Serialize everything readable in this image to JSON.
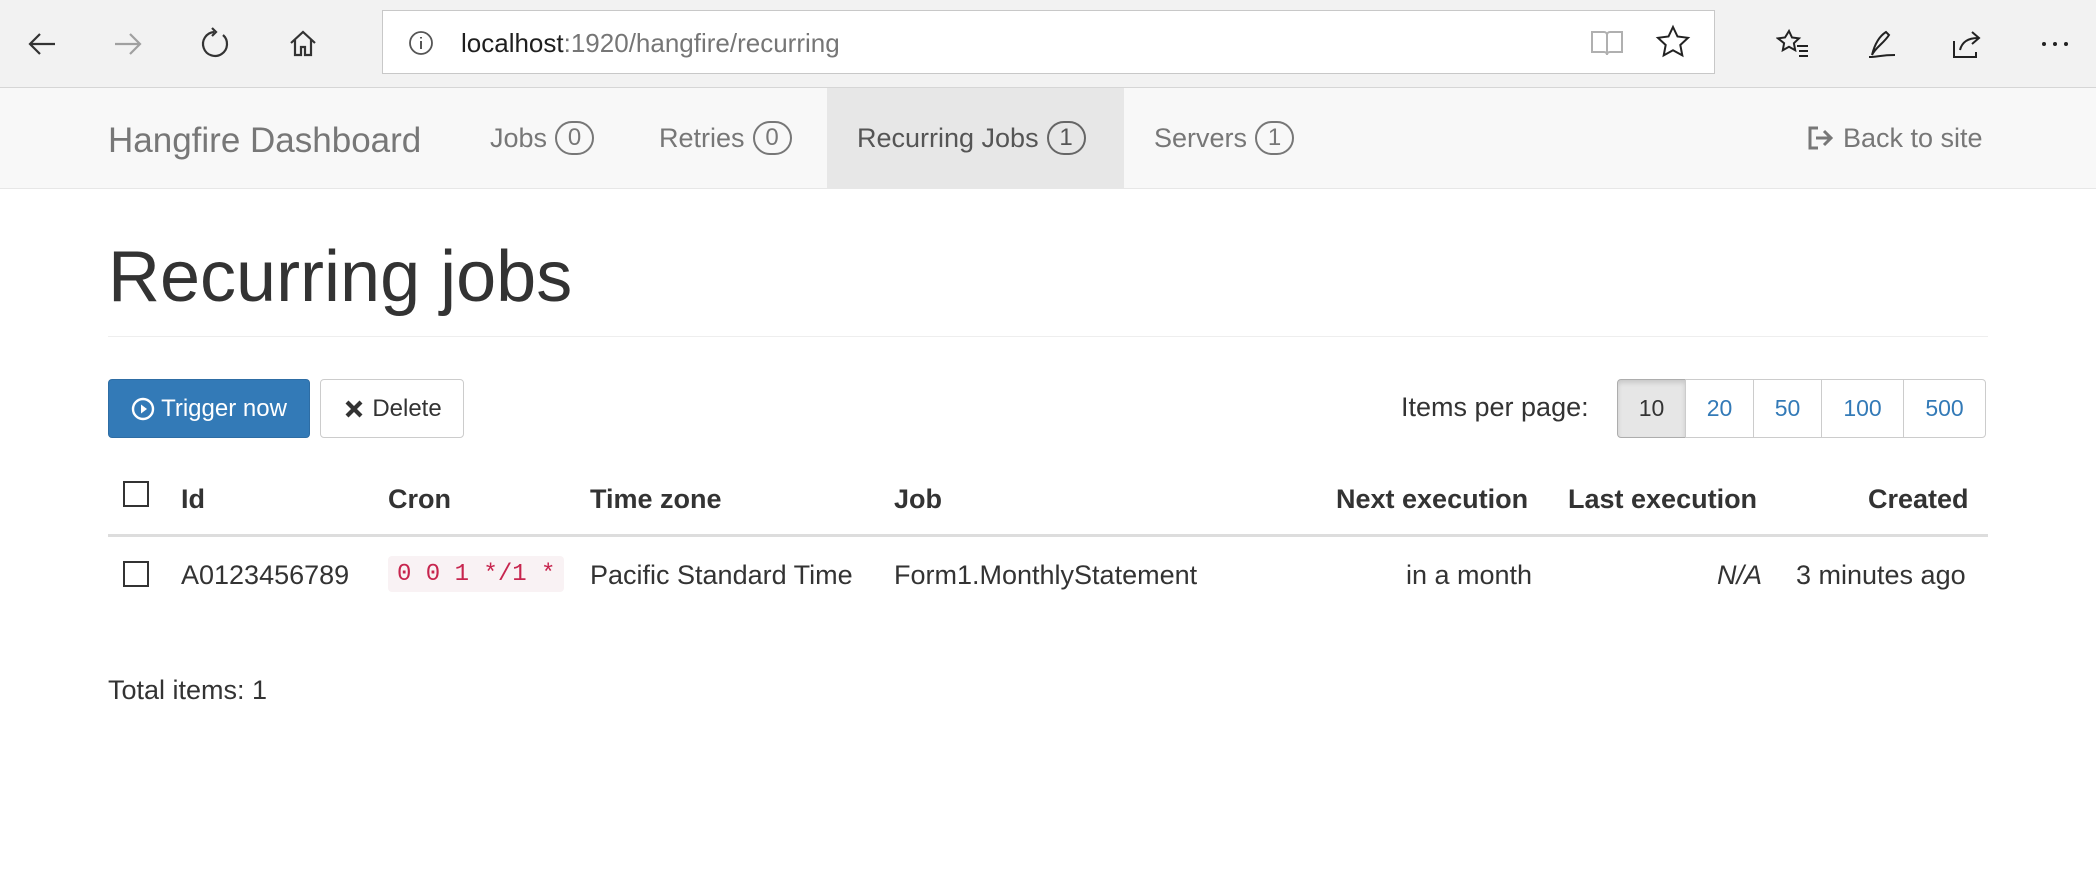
{
  "browser": {
    "url_host": "localhost",
    "url_path": ":1920/hangfire/recurring"
  },
  "navbar": {
    "brand": "Hangfire Dashboard",
    "items": [
      {
        "label": "Jobs",
        "count": "0",
        "active": false
      },
      {
        "label": "Retries",
        "count": "0",
        "active": false
      },
      {
        "label": "Recurring Jobs",
        "count": "1",
        "active": true
      },
      {
        "label": "Servers",
        "count": "1",
        "active": false
      }
    ],
    "back_label": "Back to site"
  },
  "page": {
    "title": "Recurring jobs",
    "trigger_label": "Trigger now",
    "delete_label": "Delete",
    "items_per_page_label": "Items per page:",
    "page_sizes": [
      "10",
      "20",
      "50",
      "100",
      "500"
    ],
    "selected_page_size": "10",
    "total_label": "Total items: 1"
  },
  "table": {
    "columns": [
      "Id",
      "Cron",
      "Time zone",
      "Job",
      "Next execution",
      "Last execution",
      "Created"
    ],
    "rows": [
      {
        "id": "A0123456789",
        "cron": "0 0 1 */1 *",
        "time_zone": "Pacific Standard Time",
        "job": "Form1.MonthlyStatement",
        "next_execution": "in a month",
        "last_execution": "N/A",
        "created": "3 minutes ago"
      }
    ]
  },
  "colors": {
    "primary": "#337ab7",
    "cron_text": "#c7254e",
    "cron_bg": "#f9f2f4",
    "navbar_bg": "#f8f8f8",
    "nav_active_bg": "#e7e7e7"
  },
  "icons": {
    "back": "back-arrow-icon",
    "forward": "forward-arrow-icon",
    "refresh": "refresh-icon",
    "home": "home-icon",
    "info": "info-icon",
    "reader": "reading-view-icon",
    "star": "star-icon",
    "favorites": "favorites-icon",
    "notes": "pen-icon",
    "share": "share-icon",
    "more": "more-icon",
    "trigger": "play-circle-icon",
    "delete": "times-icon",
    "back_to_site": "sign-out-icon"
  }
}
